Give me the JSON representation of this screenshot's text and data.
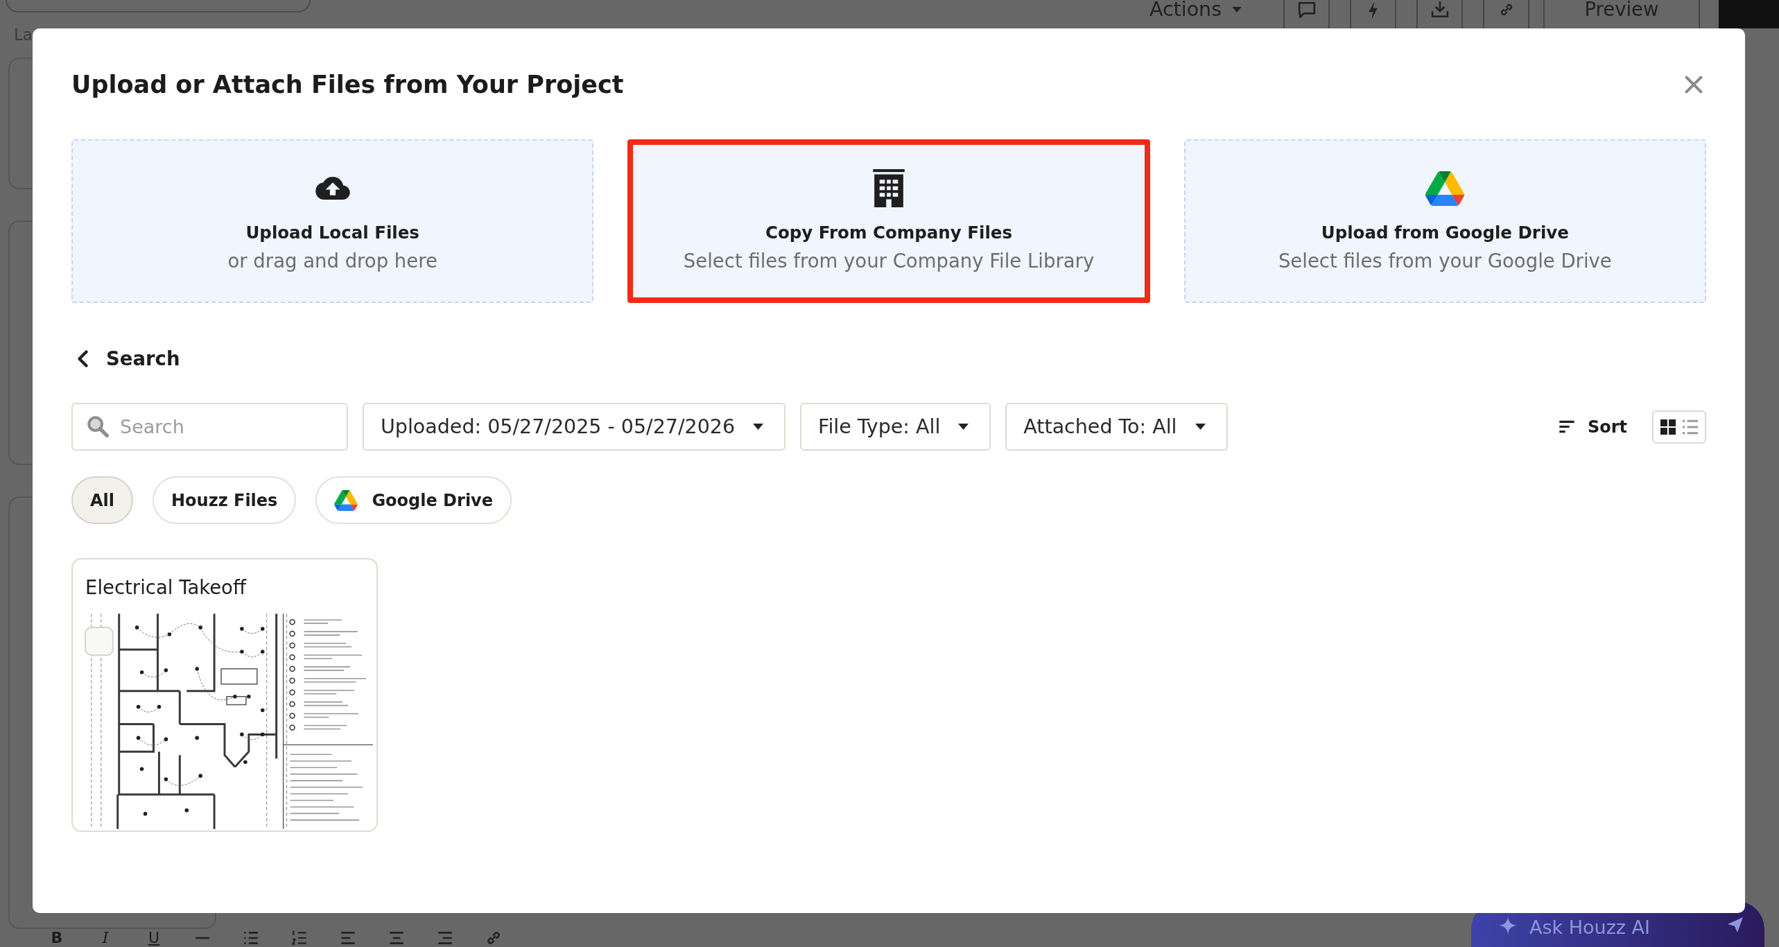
{
  "background": {
    "top_bar": {
      "menu": "Actions",
      "preview": "Preview"
    },
    "status_text": "La",
    "format_tools": [
      {
        "kind": "bold",
        "label": "B"
      },
      {
        "kind": "italic",
        "label": "I"
      },
      {
        "kind": "underline",
        "label": "U"
      }
    ],
    "assistant_button": "Ask Houzz AI"
  },
  "dialog": {
    "title": "Upload or Attach Files from Your Project",
    "sources": [
      {
        "kind": "upload",
        "title": "Upload Local Files",
        "subtitle": "or drag and drop here",
        "selected": false
      },
      {
        "kind": "company",
        "title": "Copy From Company Files",
        "subtitle": "Select files from your Company File Library",
        "selected": true
      },
      {
        "kind": "drive",
        "title": "Upload from Google Drive",
        "subtitle": "Select files from your Google Drive",
        "selected": false
      }
    ],
    "back_link": "Search",
    "filters": {
      "search": {
        "placeholder": "Search"
      },
      "dropdowns": [
        {
          "label": "Uploaded: 05/27/2025 - 05/27/2026"
        },
        {
          "label": "File Type: All"
        },
        {
          "label": "Attached To: All"
        }
      ],
      "sort": "Sort",
      "views": [
        {
          "kind": "grid",
          "selected": true
        },
        {
          "kind": "list",
          "selected": false
        }
      ]
    },
    "source_filters": [
      {
        "kind": "plain",
        "label": "All",
        "selected": true
      },
      {
        "kind": "plain",
        "label": "Houzz Files",
        "selected": false
      },
      {
        "kind": "drive",
        "label": "Google Drive",
        "selected": false
      }
    ],
    "files": [
      {
        "name": "Electrical Takeoff",
        "checked": false
      }
    ]
  }
}
